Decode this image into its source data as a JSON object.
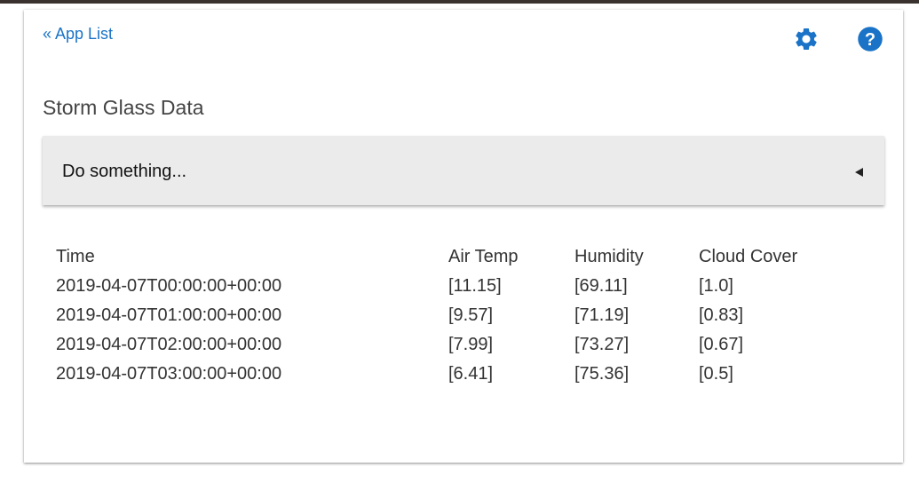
{
  "nav": {
    "back_label": "« App List"
  },
  "icons": {
    "settings": "gear-icon",
    "help": "help-icon",
    "accent_color": "#1a73c7"
  },
  "page": {
    "title": "Storm Glass Data"
  },
  "action_select": {
    "value": "Do something..."
  },
  "table": {
    "headers": [
      "Time",
      "Air Temp",
      "Humidity",
      "Cloud Cover"
    ],
    "rows": [
      [
        "2019-04-07T00:00:00+00:00",
        "[11.15]",
        "[69.11]",
        "[1.0]"
      ],
      [
        "2019-04-07T01:00:00+00:00",
        "[9.57]",
        "[71.19]",
        "[0.83]"
      ],
      [
        "2019-04-07T02:00:00+00:00",
        "[7.99]",
        "[73.27]",
        "[0.67]"
      ],
      [
        "2019-04-07T03:00:00+00:00",
        "[6.41]",
        "[75.36]",
        "[0.5]"
      ]
    ]
  }
}
